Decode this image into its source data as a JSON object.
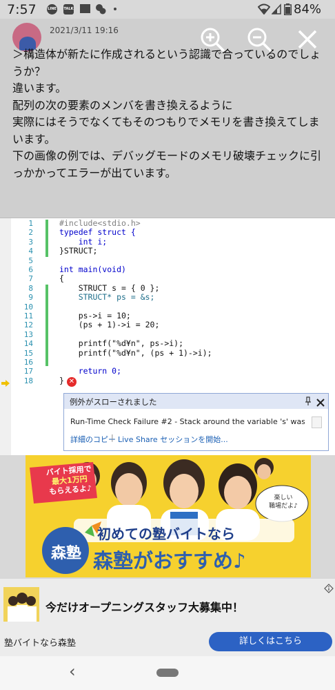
{
  "status_bar": {
    "time": "7:57",
    "icons": [
      "line-icon",
      "talk-icon",
      "mail-icon",
      "chat-bubbles-icon",
      "dot-icon"
    ],
    "icon_labels": {
      "line": "LINE",
      "talk": "TALK"
    },
    "signal_icons": [
      "wifi-icon",
      "cell-signal-icon",
      "battery-icon"
    ],
    "battery": "84%"
  },
  "post": {
    "date": "2021/3/11 19:16",
    "paragraphs": [
      "＞構造体が新たに作成されるという認識で合っているのでしょうか？",
      "",
      "違います。",
      "配列の次の要素のメンバを書き換えるように",
      "実際にはそうでなくてもそのつもりでメモリを書き換えてしまいます。",
      "",
      "下の画像の例では、デバッグモードのメモリ破壊チェックに引っかかってエラーが出ています。"
    ]
  },
  "viewer_controls": {
    "zoom_in": "zoom-in-icon",
    "zoom_out": "zoom-out-icon",
    "close": "close-icon"
  },
  "code": {
    "line_numbers": [
      "1",
      "2",
      "3",
      "4",
      "5",
      "6",
      "7",
      "8",
      "9",
      "10",
      "11",
      "12",
      "13",
      "14",
      "15",
      "16",
      "17",
      "18"
    ],
    "lines": [
      "#include<stdio.h>",
      "typedef struct {",
      "    int i;",
      "}STRUCT;",
      "",
      "int main(void)",
      "{",
      "    STRUCT s = { 0 };",
      "    STRUCT* ps = &s;",
      "",
      "    ps->i = 10;",
      "    (ps + 1)->i = 20;",
      "",
      "    printf(\"%d¥n\", ps->i);",
      "    printf(\"%d¥n\", (ps + 1)->i);",
      "",
      "    return 0;",
      "}"
    ],
    "exception": {
      "title": "例外がスローされました",
      "message": "Run-Time Check Failure #2 - Stack around the variable 's' was",
      "link_copy": "詳細のコピー",
      "separator": "|",
      "link_share": "Live Share セッションを開始..."
    }
  },
  "ad_banner": {
    "badge_lines": [
      "バイト採用で",
      "最大1万円",
      "もらえるよ♪"
    ],
    "bubble_lines": [
      "楽しい",
      "職場だよ♪"
    ],
    "logo": "森塾",
    "headline1": "初めての塾バイトなら",
    "headline2": "森塾がおすすめ♪"
  },
  "ad_bar": {
    "text": "今だけオープニングスタッフ大募集中！",
    "advertiser": "塾バイトなら森塾",
    "cta": "詳しくはこちら",
    "colors": {
      "cta": "#2c62c4"
    }
  },
  "nav": {
    "back": "‹"
  }
}
